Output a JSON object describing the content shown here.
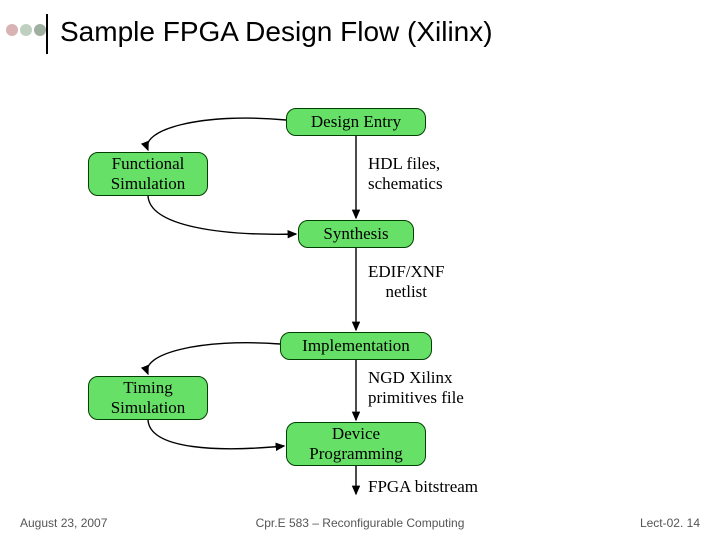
{
  "title": "Sample FPGA Design Flow (Xilinx)",
  "dots": [
    "#d9b3b3",
    "#c0d0c0",
    "#a0b0a0"
  ],
  "boxes": {
    "design_entry": "Design Entry",
    "functional_sim": "Functional\nSimulation",
    "synthesis": "Synthesis",
    "implementation": "Implementation",
    "timing_sim": "Timing\nSimulation",
    "device_prog": "Device\nProgramming"
  },
  "labels": {
    "hdl": "HDL files,\nschematics",
    "edif": "EDIF/XNF\nnetlist",
    "ngd": "NGD Xilinx\nprimitives file",
    "bitstream": "FPGA bitstream"
  },
  "footer": {
    "date": "August 23, 2007",
    "course": "Cpr.E 583 – Reconfigurable Computing",
    "page": "Lect-02. 14"
  }
}
